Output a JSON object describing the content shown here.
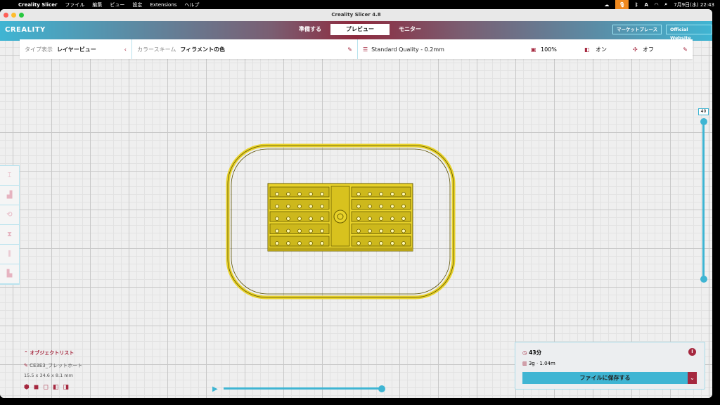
{
  "menubar": {
    "app": "Creality Slicer",
    "items": [
      "ファイル",
      "編集",
      "ビュー",
      "設定",
      "Extensions",
      "ヘルプ"
    ],
    "clock": "7月9日(水) 22:43"
  },
  "window": {
    "title": "Creality Slicer 4.8"
  },
  "header": {
    "logo": "CREALITY",
    "tabs": [
      "準備する",
      "プレビュー",
      "モニター"
    ],
    "active_tab": "プレビュー",
    "marketplace": "マーケットプレース",
    "website": "Official Website"
  },
  "settings": {
    "type_label": "タイプ表示",
    "type_value": "レイヤービュー",
    "color_label": "カラースキーム",
    "color_value": "フィラメントの色",
    "profile": "Standard Quality - 0.2mm",
    "infill": "100%",
    "support": "オン",
    "adhesion": "オフ"
  },
  "layer_slider": {
    "current_layer": "40",
    "min_fraction": 0,
    "max_fraction": 1
  },
  "object_list": {
    "title": "オブジェクトリスト",
    "object_name": "CE3E3_フレットホート",
    "dimensions": "15.5 x 34.6 x 8.1 mm"
  },
  "playback": {
    "progress": 1.0
  },
  "print_info": {
    "time": "43分",
    "material": "3g · 1.04m",
    "save_button": "ファイルに保存する"
  },
  "colors": {
    "accent": "#3fb5d3",
    "brand_red": "#a5283f",
    "model": "#e8d22a"
  }
}
